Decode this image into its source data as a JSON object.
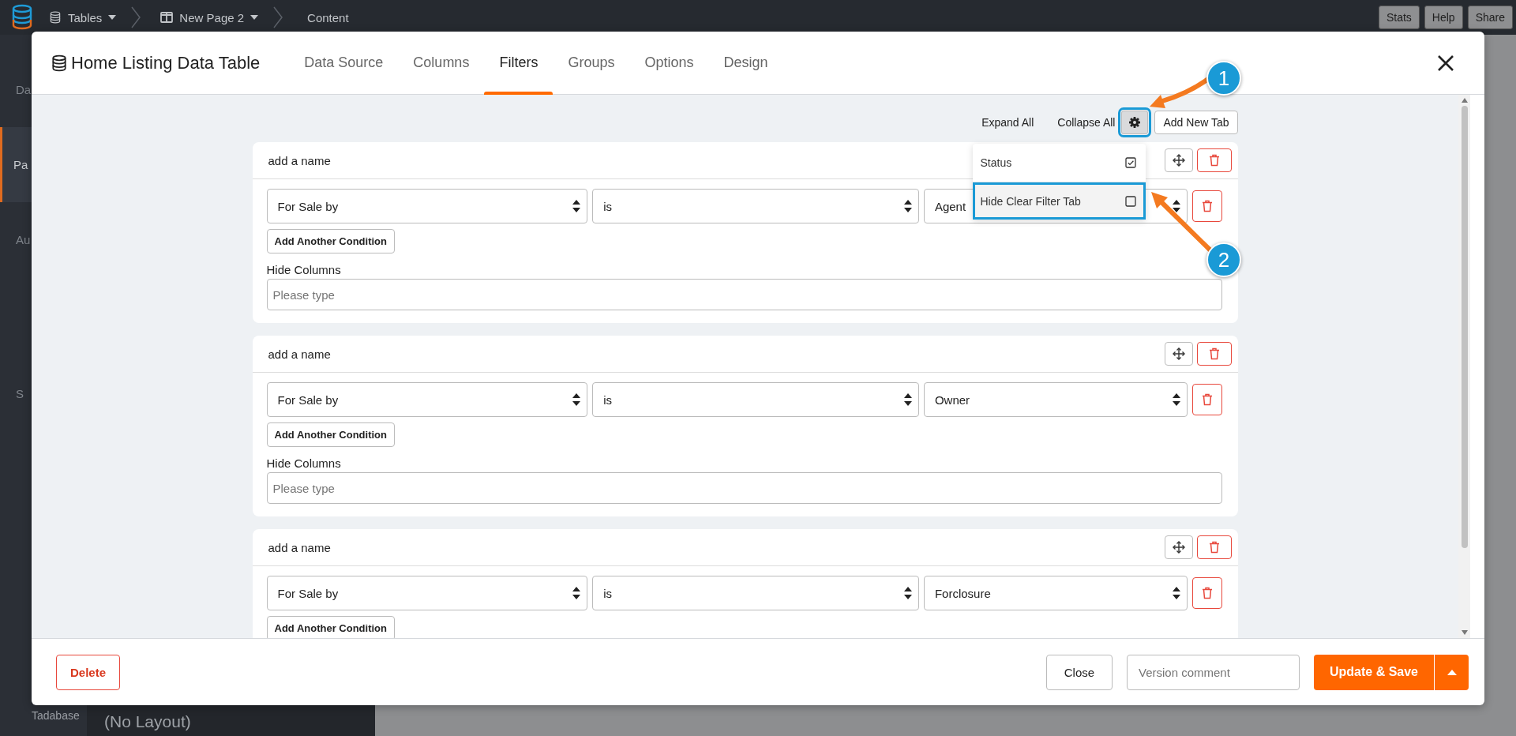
{
  "top_bar": {
    "breadcrumbs": [
      {
        "label": "Tables",
        "kind": "table",
        "dropdown": true
      },
      {
        "label": "New Page 2",
        "kind": "page",
        "dropdown": true
      },
      {
        "label": "Content",
        "kind": "current",
        "dropdown": false
      }
    ],
    "buttons": [
      "Stats",
      "Help",
      "Share"
    ]
  },
  "sidebar": {
    "items": [
      {
        "label": "Da",
        "selected": false
      },
      {
        "label": "Pa",
        "selected": true
      },
      {
        "label": "Au",
        "selected": false
      },
      {
        "label": "S",
        "selected": false
      }
    ],
    "footer": "Tadabase"
  },
  "background": {
    "layout_label": "(No Layout)"
  },
  "modal": {
    "title": "Home Listing Data Table",
    "tabs": [
      {
        "label": "Data Source",
        "selected": false
      },
      {
        "label": "Columns",
        "selected": false
      },
      {
        "label": "Filters",
        "selected": true
      },
      {
        "label": "Groups",
        "selected": false
      },
      {
        "label": "Options",
        "selected": false
      },
      {
        "label": "Design",
        "selected": false
      }
    ],
    "toolbar": {
      "expand": "Expand All",
      "collapse": "Collapse All",
      "settings_highlighted": true,
      "add": "Add New Tab"
    },
    "settings_menu": {
      "items": [
        {
          "label": "Status",
          "checked": true,
          "highlighted": false
        },
        {
          "label": "Hide Clear Filter Tab",
          "checked": false,
          "highlighted": true
        }
      ]
    },
    "filters": [
      {
        "name_placeholder": "add a name",
        "conditions": [
          {
            "field": "For Sale by",
            "operator": "is",
            "value": "Agent"
          }
        ],
        "add_condition": "Add Another Condition",
        "hide_columns_label": "Hide Columns",
        "hide_columns_placeholder": "Please type"
      },
      {
        "name_placeholder": "add a name",
        "conditions": [
          {
            "field": "For Sale by",
            "operator": "is",
            "value": "Owner"
          }
        ],
        "add_condition": "Add Another Condition",
        "hide_columns_label": "Hide Columns",
        "hide_columns_placeholder": "Please type"
      },
      {
        "name_placeholder": "add a name",
        "conditions": [
          {
            "field": "For Sale by",
            "operator": "is",
            "value": "Forclosure"
          }
        ],
        "add_condition": "Add Another Condition"
      }
    ],
    "footer": {
      "delete": "Delete",
      "close": "Close",
      "version_placeholder": "Version comment",
      "save": "Update & Save"
    }
  },
  "annotations": [
    {
      "number": "1"
    },
    {
      "number": "2"
    }
  ]
}
